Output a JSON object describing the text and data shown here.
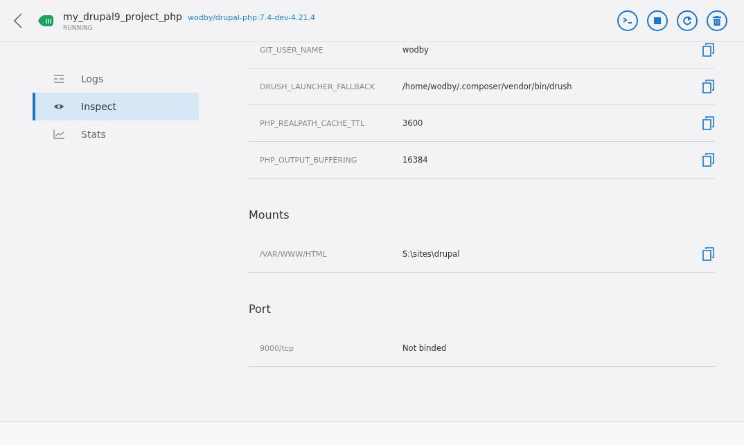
{
  "header": {
    "title": "my_drupal9_project_php",
    "image": "wodby/drupal-php:7.4-dev-4.21.4",
    "status": "RUNNING",
    "actions": [
      {
        "kind": "terminal"
      },
      {
        "kind": "stop"
      },
      {
        "kind": "restart"
      },
      {
        "kind": "delete"
      }
    ]
  },
  "sidebar": {
    "items": [
      {
        "label": "Logs",
        "kind": "logs",
        "selected": false
      },
      {
        "label": "Inspect",
        "kind": "inspect",
        "selected": true
      },
      {
        "label": "Stats",
        "kind": "stats",
        "selected": false
      }
    ]
  },
  "env": [
    {
      "key": "GIT_USER_NAME",
      "value": "wodby",
      "copy": true
    },
    {
      "key": "DRUSH_LAUNCHER_FALLBACK",
      "value": "/home/wodby/.composer/vendor/bin/drush",
      "copy": true
    },
    {
      "key": "PHP_REALPATH_CACHE_TTL",
      "value": "3600",
      "copy": true
    },
    {
      "key": "PHP_OUTPUT_BUFFERING",
      "value": "16384",
      "copy": true
    }
  ],
  "sections": [
    {
      "title": "Mounts",
      "rows": [
        {
          "key": "/VAR/WWW/HTML",
          "value": "S:\\sites\\drupal",
          "copy": true
        }
      ]
    },
    {
      "title": "Port",
      "rows": [
        {
          "key": "9000/tcp",
          "value": "Not binded",
          "copy": false
        }
      ]
    }
  ]
}
